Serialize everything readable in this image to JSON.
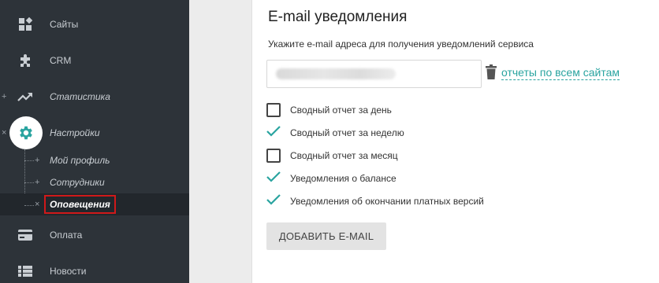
{
  "sidebar": {
    "items": [
      {
        "label": "Сайты",
        "icon": "sites-widgets-icon"
      },
      {
        "label": "CRM",
        "icon": "puzzle-icon"
      },
      {
        "label": "Статистика",
        "icon": "trending-up-icon",
        "toggle": "+"
      },
      {
        "label": "Настройки",
        "icon": "gear-icon",
        "toggle": "×"
      },
      {
        "label": "Оплата",
        "icon": "credit-card-icon"
      },
      {
        "label": "Новости",
        "icon": "list-icon"
      }
    ],
    "sub_items": [
      {
        "label": "Мой профиль",
        "marker": "+"
      },
      {
        "label": "Сотрудники",
        "marker": "+"
      },
      {
        "label": "Оповещения",
        "marker": "×"
      }
    ]
  },
  "main": {
    "title": "E-mail уведомления",
    "subtitle": "Укажите e-mail адреса для получения уведомлений сервиса",
    "email_value": "",
    "reports_link": "отчеты по всем сайтам",
    "checkboxes": [
      {
        "label": "Сводный отчет за день",
        "checked": false
      },
      {
        "label": "Сводный отчет за неделю",
        "checked": true
      },
      {
        "label": "Сводный отчет за месяц",
        "checked": false
      },
      {
        "label": "Уведомления о балансе",
        "checked": true
      },
      {
        "label": "Уведомления об окончании платных версий",
        "checked": true
      }
    ],
    "add_button": "ДОБАВИТЬ E-MAIL"
  },
  "colors": {
    "sidebar_bg": "#2d3339",
    "accent": "#2aa4a0",
    "highlight_border": "#d0191a"
  }
}
